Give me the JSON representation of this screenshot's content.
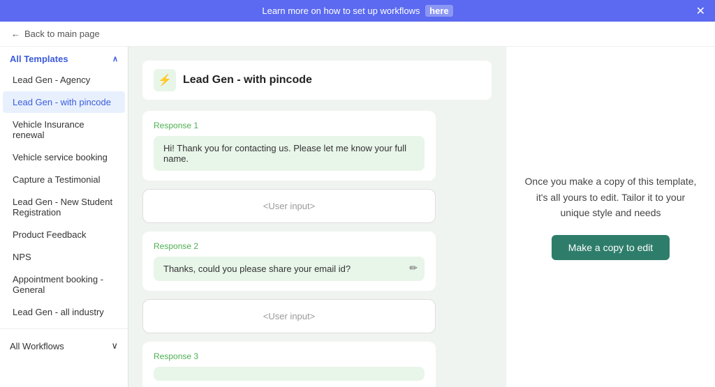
{
  "banner": {
    "text": "Learn more on how to set up workflows",
    "link_label": "here",
    "close_label": "✕"
  },
  "back_nav": {
    "label": "Back to main page"
  },
  "sidebar": {
    "all_templates_label": "All Templates",
    "items": [
      {
        "id": "lead-gen-agency",
        "label": "Lead Gen - Agency",
        "active": false
      },
      {
        "id": "lead-gen-pincode",
        "label": "Lead Gen - with pincode",
        "active": true
      },
      {
        "id": "vehicle-insurance",
        "label": "Vehicle Insurance renewal",
        "active": false
      },
      {
        "id": "vehicle-service",
        "label": "Vehicle service booking",
        "active": false
      },
      {
        "id": "capture-testimonial",
        "label": "Capture a Testimonial",
        "active": false
      },
      {
        "id": "lead-gen-student",
        "label": "Lead Gen - New Student Registration",
        "active": false
      },
      {
        "id": "product-feedback",
        "label": "Product Feedback",
        "active": false
      },
      {
        "id": "nps",
        "label": "NPS",
        "active": false
      },
      {
        "id": "appointment-general",
        "label": "Appointment booking - General",
        "active": false
      },
      {
        "id": "lead-gen-industry",
        "label": "Lead Gen - all industry",
        "active": false
      }
    ],
    "workflows_label": "All Workflows"
  },
  "template": {
    "title": "Lead Gen - with pincode",
    "icon": "⚡",
    "responses": [
      {
        "label": "Response 1",
        "text": "Hi! Thank you for contacting us. Please let me know your full name.",
        "editable": false
      },
      {
        "label": "Response 2",
        "text": "Thanks, could you please share your email id?",
        "editable": true
      },
      {
        "label": "Response 3",
        "text": "",
        "editable": false
      }
    ],
    "user_input_label": "<User input>"
  },
  "right_panel": {
    "description": "Once you make a copy of this template, it's all yours to edit. Tailor it to your unique style and needs",
    "button_label": "Make a copy to edit"
  }
}
